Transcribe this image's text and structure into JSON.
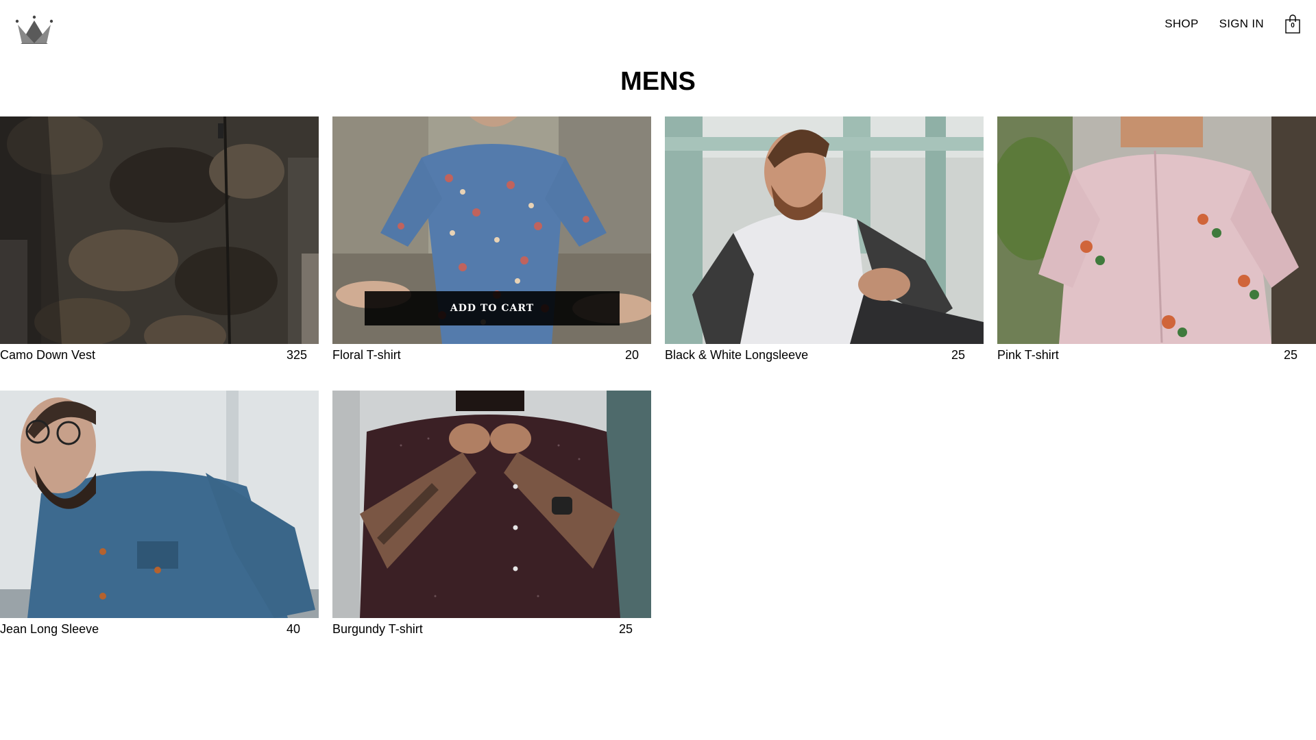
{
  "header": {
    "logo_icon": "crown-icon",
    "nav": [
      {
        "label": "SHOP"
      },
      {
        "label": "SIGN IN"
      }
    ],
    "cart": {
      "icon": "shopping-bag-icon",
      "count": "0"
    }
  },
  "page": {
    "title": "MENS"
  },
  "colors": {
    "overlay_button_bg": "#111111",
    "logo_fill": "#555555"
  },
  "products": [
    {
      "name": "Camo Down Vest",
      "price": "325"
    },
    {
      "name": "Floral T-shirt",
      "price": "20",
      "add_to_cart_label": "ADD TO CART"
    },
    {
      "name": "Black & White Longsleeve",
      "price": "25"
    },
    {
      "name": "Pink T-shirt",
      "price": "25"
    },
    {
      "name": "Jean Long Sleeve",
      "price": "40"
    },
    {
      "name": "Burgundy T-shirt",
      "price": "25"
    }
  ]
}
